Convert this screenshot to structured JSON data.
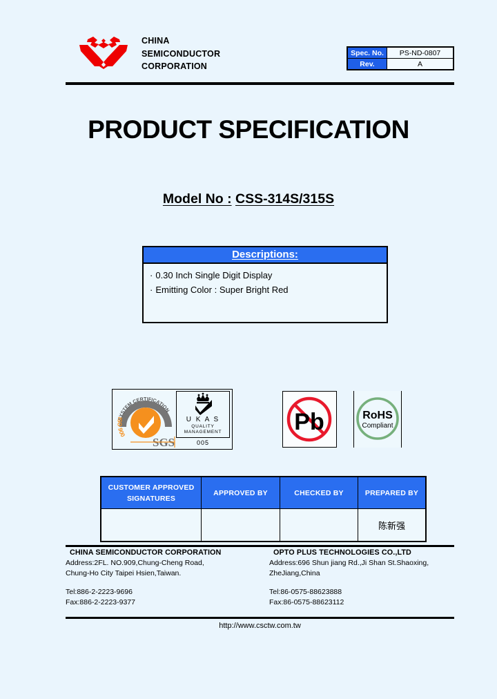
{
  "page": {
    "background_color": "#eaf5fd",
    "accent_blue": "#2a6ef0",
    "logo_red": "#ee0000"
  },
  "header": {
    "company_name": "CHINA\nSEMICONDUCTOR\nCORPORATION",
    "logo_name": "china-semiconductor-logo",
    "spec_table": {
      "spec_no_label": "Spec. No.",
      "spec_no_value": "PS-ND-0807",
      "rev_label": "Rev.",
      "rev_value": "A"
    }
  },
  "title": {
    "doc_title": "PRODUCT SPECIFICATION",
    "model_label": "Model No :",
    "model_value": "CSS-314S/315S"
  },
  "descriptions": {
    "heading": "Descriptions:",
    "items": [
      "0.30 Inch Single Digit Display",
      "Emitting Color : Super Bright Red"
    ],
    "bullet": "·"
  },
  "certifications": {
    "sgs": {
      "arc_text": "SYSTEM CERTIFICATION",
      "iso_text": "ISO 9001:2000",
      "brand": "SGS"
    },
    "ukas": {
      "title": "U K A S",
      "subtitle": "QUALITY\nMANAGEMENT",
      "number": "005"
    },
    "pb": {
      "label": "Pb"
    },
    "rohs": {
      "line1": "RoHS",
      "line2": "Compliant"
    }
  },
  "signature_table": {
    "headers": [
      "CUSTOMER APPROVED\nSIGNATURES",
      "APPROVED BY",
      "CHECKED BY",
      "PREPARED BY"
    ],
    "values": [
      "",
      "",
      "",
      "陈新强"
    ]
  },
  "footer": {
    "left": {
      "company": "CHINA SEMICONDUCTOR CORPORATION",
      "address": "Address:2FL. NO.909,Chung-Cheng Road,\n            Chung-Ho City Taipei Hsien,Taiwan.",
      "tel": "Tel:886-2-2223-9696",
      "fax": "Fax:886-2-2223-9377"
    },
    "right": {
      "company": "OPTO PLUS TECHNOLOGIES CO.,LTD",
      "address": "Address:696 Shun jiang Rd.,Ji Shan St.Shaoxing,\n            ZheJiang,China",
      "tel": "Tel:86-0575-88623888",
      "fax": "Fax:86-0575-88623112"
    },
    "website": "http://www.csctw.com.tw"
  }
}
